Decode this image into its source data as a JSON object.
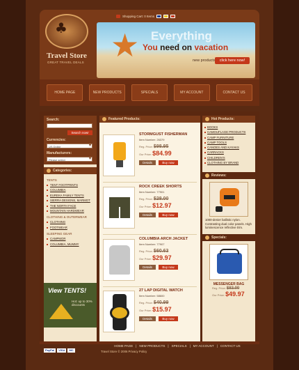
{
  "header": {
    "logo_title": "Travel Store",
    "logo_tagline": "GREAT TRAVEL DEALS",
    "cart_text": "Shopping Cart: 0 Items",
    "flags": [
      "#1a3a8a",
      "#e8c020",
      "#c4381a"
    ],
    "slogan_line1": "Everything",
    "slogan_you": "You",
    "slogan_need": "need on",
    "slogan_vacation": "vacation",
    "new_products": "new products!",
    "click_here": "click here now!"
  },
  "nav": [
    "HOME PAGE",
    "NEW PRODUCTS",
    "SPECIALS",
    "MY ACCOUNT",
    "CONTACT US"
  ],
  "left": {
    "search_label": "Search:",
    "search_button": "Search now!",
    "currencies_label": "Currencies:",
    "currency_value": "US Dollar",
    "manufacturers_label": "Manufacturers:",
    "manufacturer_value": "Please select",
    "categories_title": "Categories:",
    "groups": [
      {
        "title": "TENTS",
        "items": [
          "TENT FOOTPRINTS",
          "COLUMBIA",
          "EUREKA FAMILY TENTS",
          "SIERRA DESIGNS, MARMOT",
          "THE NORTH FACE",
          "MOUNTAIN HARDWEAR"
        ]
      },
      {
        "title": "CLOTHING & OUTERWEAR",
        "items": [
          "CLOTHING",
          "FOOTWEAR"
        ]
      },
      {
        "title": "SLEEPING GEAR",
        "items": [
          "CAMPMOR",
          "COLUMBIA, MUMMY"
        ]
      }
    ],
    "promo_title": "View TENTS!",
    "promo_sub": "Hot: up to 30% discounts",
    "payments": [
      "PayPal",
      "VISA",
      "MC"
    ]
  },
  "center": {
    "title": "Featured Products:",
    "reg_price_label": "Reg. Price:",
    "our_price_label": "Our Price:",
    "details_label": "Details",
    "buy_label": "Buy now",
    "products": [
      {
        "name": "STORMGUST FISHERMAN",
        "number": "Item Number: 26379",
        "reg": "$98.95",
        "our": "$84.99"
      },
      {
        "name": "ROCK CREEK SHORTS",
        "number": "Item Number: 77901",
        "reg": "$28.00",
        "our": "$12.97"
      },
      {
        "name": "COLUMBIA ARCH JACKET",
        "number": "Item Number: 77907",
        "reg": "$60.63",
        "our": "$29.97"
      },
      {
        "name": "27 LAP DIGITAL WATCH",
        "number": "Item Number: 58600",
        "reg": "$40.99",
        "our": "$15.97"
      }
    ]
  },
  "right": {
    "hot_title": "Hot Products:",
    "hot_items": [
      "BOOKS",
      "CAMOUFLAGE PRODUCTS",
      "CAMP FURNITURE",
      "CAMP TOOLS",
      "CANOES AND KAYAKS",
      "CARRACKS",
      "CHILDREN'S",
      "CLOTHING BY BRAND"
    ],
    "reviews_title": "Reviews:",
    "review_text": "1000-denier ballistic nylon. Contrasting dual color panels. High luminescence reflective trim.",
    "specials_title": "Specials:",
    "special_name": "MESSENGER BAG",
    "special_reg": "$83.00",
    "special_our": "$49.97"
  },
  "footer": {
    "links": [
      "HOME PAGE",
      "NEW PRODUCTS",
      "SPECIALS",
      "MY ACCOUNT",
      "CONTACT US"
    ],
    "copyright": "Travel Store © 2006 Privacy Policy"
  }
}
